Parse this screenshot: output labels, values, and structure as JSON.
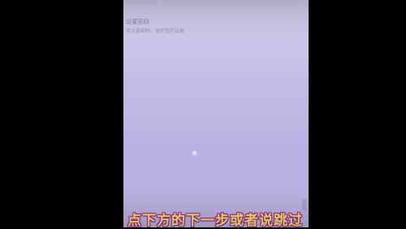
{
  "settings": {
    "title": "设置密码",
    "subtitle": "请设置密码，保护您的设备"
  },
  "subtitle_caption": "点下方的下一步或者说跳过"
}
